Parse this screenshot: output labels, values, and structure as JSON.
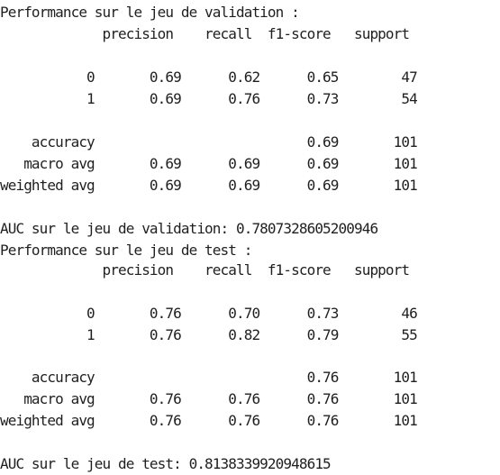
{
  "output": {
    "validation": {
      "title": "Performance sur le jeu de validation :",
      "header": "             precision    recall  f1-score   support",
      "row_0": "           0       0.69      0.62      0.65        47",
      "row_1": "           1       0.69      0.76      0.73        54",
      "accuracy": "    accuracy                           0.69       101",
      "macro": "   macro avg       0.69      0.69      0.69       101",
      "weighted": "weighted avg       0.69      0.69      0.69       101",
      "auc": "AUC sur le jeu de validation: 0.7807328605200946"
    },
    "test": {
      "title": "Performance sur le jeu de test :",
      "header": "             precision    recall  f1-score   support",
      "row_0": "           0       0.76      0.70      0.73        46",
      "row_1": "           1       0.76      0.82      0.79        55",
      "accuracy": "    accuracy                           0.76       101",
      "macro": "   macro avg       0.76      0.76      0.76       101",
      "weighted": "weighted avg       0.76      0.76      0.76       101",
      "auc": "AUC sur le jeu de test: 0.8138339920948615"
    }
  }
}
